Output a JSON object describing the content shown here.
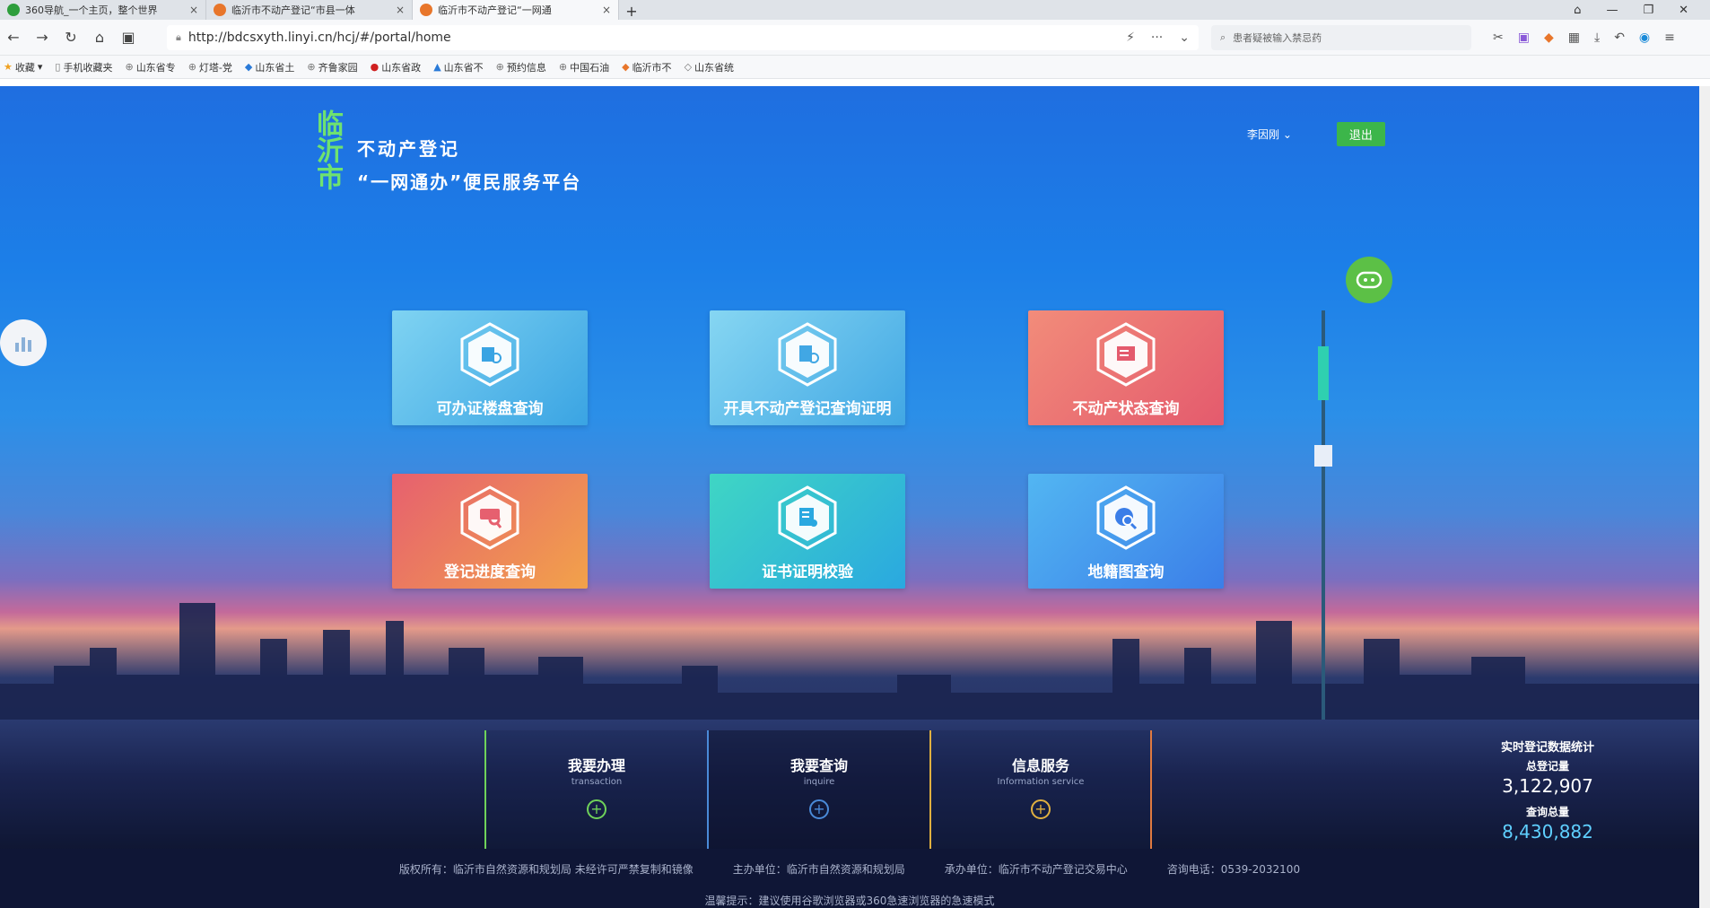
{
  "browser": {
    "tabs": [
      {
        "title": "360导航_一个主页，整个世界",
        "active": false,
        "icon_color": "#2e9e3c"
      },
      {
        "title": "临沂市不动产登记“市县一体",
        "active": false,
        "icon_color": "#e8762b"
      },
      {
        "title": "临沂市不动产登记“一网通",
        "active": true,
        "icon_color": "#e8762b"
      }
    ],
    "tab_close": "×",
    "new_tab": "+",
    "window_controls": [
      "⌂",
      "—",
      "❐",
      "✕"
    ],
    "url": "http://bdcsxyth.linyi.cn/hcj/#/portal/home",
    "search_placeholder": "患者疑被输入禁忌药",
    "bookmarks": [
      "收藏",
      "手机收藏夹",
      "山东省专",
      "灯塔-党",
      "山东省土",
      "齐鲁家园",
      "山东省政",
      "山东省不",
      "预约信息",
      "中国石油",
      "临沂市不",
      "山东省统"
    ]
  },
  "header": {
    "logo_mark": "临沂市",
    "title_line1": "不动产登记",
    "title_line2": "“一网通办”便民服务平台",
    "username": "李因刚",
    "logout_label": "退出"
  },
  "tiles": [
    {
      "label": "可办证楼盘查询",
      "icon": "building-search-icon"
    },
    {
      "label": "开具不动产登记查询证明",
      "icon": "certificate-icon"
    },
    {
      "label": "不动产状态查询",
      "icon": "status-query-icon"
    },
    {
      "label": "登记进度查询",
      "icon": "progress-query-icon"
    },
    {
      "label": "证书证明校验",
      "icon": "certificate-verify-icon"
    },
    {
      "label": "地籍图查询",
      "icon": "map-query-icon"
    }
  ],
  "bottom_nav": [
    {
      "title": "我要办理",
      "sub": "transaction"
    },
    {
      "title": "我要查询",
      "sub": "inquire"
    },
    {
      "title": "信息服务",
      "sub": "Information service"
    }
  ],
  "stats": {
    "title": "实时登记数据统计",
    "total_label": "总登记量",
    "total_value": "3,122,907",
    "query_label": "查询总量",
    "query_value": "8,430,882"
  },
  "footer": {
    "copyright": "版权所有：临沂市自然资源和规划局 未经许可严禁复制和镜像",
    "host": "主办单位：临沂市自然资源和规划局",
    "undertaker": "承办单位：临沂市不动产登记交易中心",
    "phone": "咨询电话：0539-2032100",
    "tip": "温馨提示：建议使用谷歌浏览器或360急速浏览器的急速模式"
  },
  "colors": {
    "logo_green": "#6fe26f",
    "logout_green": "#3cb64a",
    "stat_query": "#5fd0ff"
  }
}
